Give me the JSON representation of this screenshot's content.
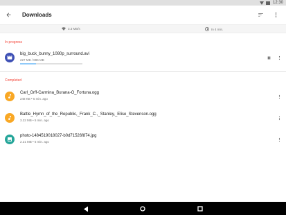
{
  "status_bar": {
    "time": "12:30"
  },
  "toolbar": {
    "title": "Downloads",
    "back_icon": "arrow-back-icon",
    "sort_icon": "sort-icon",
    "overflow_icon": "more-vertical-icon"
  },
  "info_bar": {
    "speed": "3.3 MB/s",
    "eta": "In 4 min."
  },
  "in_progress": {
    "label": "In progress",
    "items": [
      {
        "name": "big_buck_bunny_1080p_surround.avi",
        "meta": "227 MB / 886 MB",
        "progress": 0.256,
        "icon": "video-icon",
        "icon_color": "#3f51b5"
      }
    ]
  },
  "completed": {
    "label": "Completed",
    "items": [
      {
        "name": "Carl_Orff-Carmina_Burana-O_Fortuna.ogg",
        "meta": "248 KB • 5 min. ago",
        "icon": "music-icon",
        "icon_color": "#f9a825"
      },
      {
        "name": "Battle_Hymn_of_the_Republic,_Frank_C.,_Stanley,_Elise_Stevenson.ogg",
        "meta": "3.22 MB • 5 min. ago",
        "icon": "music-icon",
        "icon_color": "#f9a825"
      },
      {
        "name": "photo-1484519018027-b0d71526f874.jpg",
        "meta": "2.21 MB • 6 min. ago",
        "icon": "image-icon",
        "icon_color": "#26a69a"
      }
    ]
  },
  "colors": {
    "accent": "#f44336",
    "progress": "#90caf9"
  }
}
